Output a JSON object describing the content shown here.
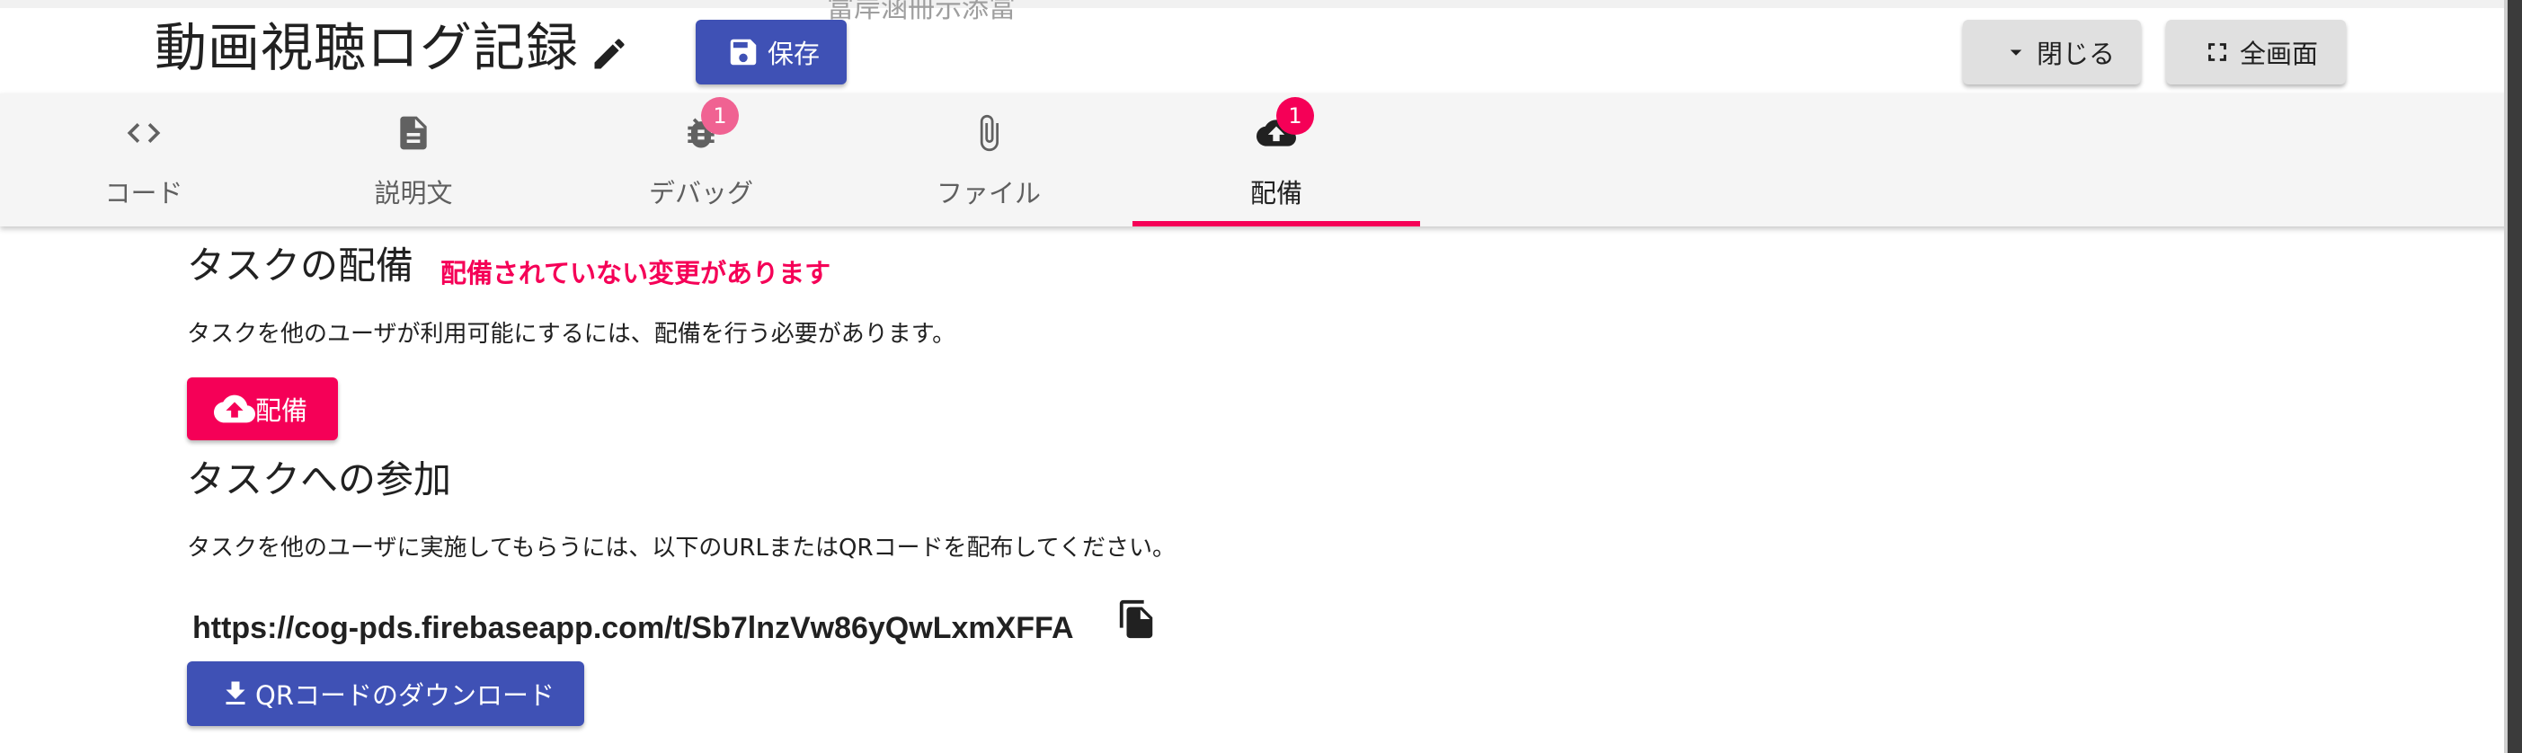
{
  "header": {
    "title": "動画視聴ログ記録",
    "clipped_text": "富岸涵冊示添冨",
    "save_label": "保存",
    "close_label": "閉じる",
    "fullscreen_label": "全画面"
  },
  "tabs": [
    {
      "label": "コード",
      "icon": "code-icon"
    },
    {
      "label": "説明文",
      "icon": "description-icon"
    },
    {
      "label": "デバッグ",
      "icon": "bug-icon",
      "badge": "1"
    },
    {
      "label": "ファイル",
      "icon": "attachment-icon"
    },
    {
      "label": "配備",
      "icon": "cloud-upload-icon",
      "badge": "1",
      "active": true
    }
  ],
  "deploy": {
    "heading": "タスクの配備",
    "warning": "配備されていない変更があります",
    "description": "タスクを他のユーザが利用可能にするには、配備を行う必要があります。",
    "button_label": "配備"
  },
  "participation": {
    "heading": "タスクへの参加",
    "description": "タスクを他のユーザに実施してもらうには、以下のURLまたはQRコードを配布してください。",
    "url": "https://cog-pds.firebaseapp.com/t/Sb7lnzVw86yQwLxmXFFA",
    "qr_button_label": "QRコードのダウンロード"
  },
  "colors": {
    "primary": "#3f51b5",
    "secondary": "#f50057",
    "tab_bar": "#f5f5f5",
    "grey_button": "#e0e0e0"
  }
}
